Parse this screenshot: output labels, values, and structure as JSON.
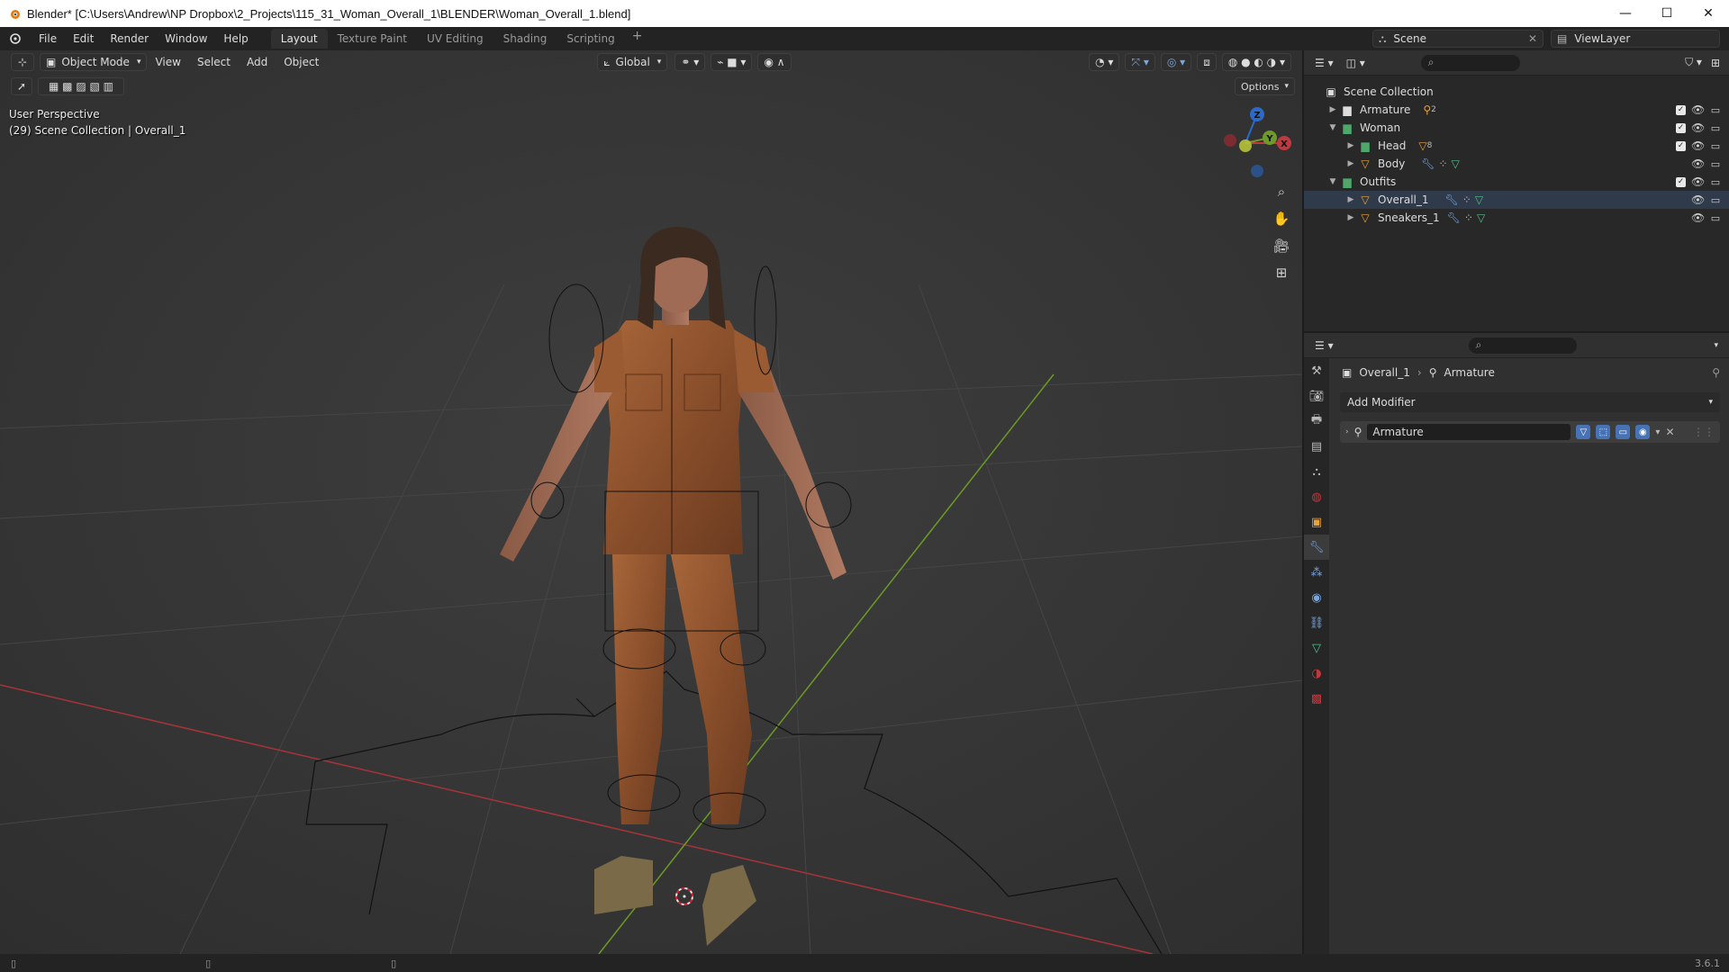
{
  "window": {
    "title": "Blender* [C:\\Users\\Andrew\\NP Dropbox\\2_Projects\\115_31_Woman_Overall_1\\BLENDER\\Woman_Overall_1.blend]",
    "minimize": "—",
    "maximize": "☐",
    "close": "✕"
  },
  "menu": {
    "file": "File",
    "edit": "Edit",
    "render": "Render",
    "window": "Window",
    "help": "Help"
  },
  "workspaces": [
    "Layout",
    "Texture Paint",
    "UV Editing",
    "Shading",
    "Scripting"
  ],
  "active_workspace": "Layout",
  "add_workspace": "+",
  "scene": {
    "name": "Scene",
    "view_layer": "ViewLayer"
  },
  "viewport": {
    "mode": "Object Mode",
    "menus": [
      "View",
      "Select",
      "Add",
      "Object"
    ],
    "orientation": "Global",
    "options": "Options",
    "perspective": "User Perspective",
    "collection_info": "(29) Scene Collection | Overall_1",
    "gizmo": {
      "x": "X",
      "y": "Y",
      "z": "Z"
    }
  },
  "outliner": {
    "root": "Scene Collection",
    "rows": [
      {
        "label": "Armature",
        "badge": "2"
      },
      {
        "label": "Woman"
      },
      {
        "label": "Head",
        "badge": "8"
      },
      {
        "label": "Body"
      },
      {
        "label": "Outfits"
      },
      {
        "label": "Overall_1"
      },
      {
        "label": "Sneakers_1"
      }
    ]
  },
  "properties": {
    "object": "Overall_1",
    "data": "Armature",
    "add_modifier": "Add Modifier",
    "modifier_name": "Armature"
  },
  "status": {
    "version": "3.6.1"
  },
  "colors": {
    "accent": "#4772b3",
    "x_axis": "#c0393f",
    "y_axis": "#6e9a2a",
    "z_axis": "#2c6ac9",
    "collection": "#4fa86a",
    "mesh": "#e8a13d"
  }
}
